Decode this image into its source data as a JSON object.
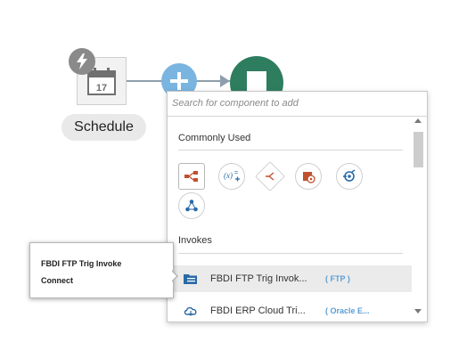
{
  "canvas": {
    "schedule_label": "Schedule",
    "calendar_day": "17",
    "colors": {
      "add_button": "#7ab4e0",
      "end_node": "#2e7d5f",
      "trigger_badge": "#8a8a8a"
    }
  },
  "panel": {
    "search": {
      "placeholder": "Search for component to add",
      "value": ""
    },
    "sections": {
      "commonly_used": "Commonly Used",
      "invokes": "Invokes"
    },
    "common_components": [
      {
        "icon": "map-icon",
        "selected": true
      },
      {
        "icon": "assign-variable-icon"
      },
      {
        "icon": "switch-icon"
      },
      {
        "icon": "stage-file-icon"
      },
      {
        "icon": "for-each-icon"
      },
      {
        "icon": "integration-icon"
      }
    ],
    "invokes": [
      {
        "name": "FBDI FTP Trig Invok...",
        "type": "( FTP )",
        "icon": "ftp-folder-icon",
        "highlighted": true
      },
      {
        "name": "FBDI ERP Cloud Tri...",
        "type": "( Oracle E...",
        "icon": "cloud-icon"
      }
    ]
  },
  "tooltip": {
    "title": "FBDI FTP Trig Invoke",
    "action": "Connect"
  }
}
